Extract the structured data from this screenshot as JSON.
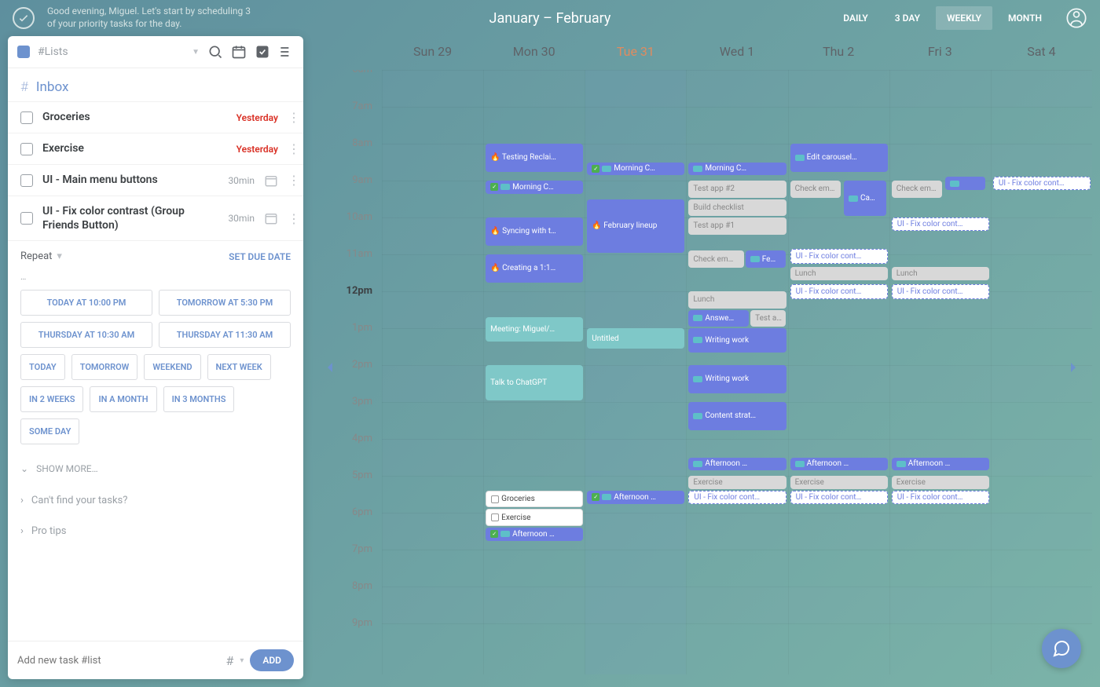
{
  "header": {
    "greeting": "Good evening, Miguel. Let's start by scheduling 3 of your priority tasks for the day.",
    "title": "January – February",
    "views": [
      "DAILY",
      "3 DAY",
      "WEEKLY",
      "MONTH"
    ],
    "active_view": "WEEKLY"
  },
  "sidebar": {
    "list_label": "#Lists",
    "section": "Inbox",
    "tasks": [
      {
        "label": "Groceries",
        "due": "Yesterday",
        "due_style": "overdue"
      },
      {
        "label": "Exercise",
        "due": "Yesterday",
        "due_style": "overdue"
      },
      {
        "label": "UI - Main menu buttons",
        "due": "30min",
        "due_style": "neutral",
        "has_cal": true
      },
      {
        "label": "UI - Fix color contrast (Group Friends Button)",
        "due": "30min",
        "due_style": "neutral",
        "has_cal": true
      }
    ],
    "repeat_label": "Repeat",
    "set_due_label": "SET DUE DATE",
    "chips_primary": [
      "TODAY AT 10:00 PM",
      "TOMORROW AT 5:30 PM",
      "THURSDAY AT 10:30 AM",
      "THURSDAY AT 11:30 AM"
    ],
    "chips_secondary": [
      "TODAY",
      "TOMORROW",
      "WEEKEND",
      "NEXT WEEK",
      "IN 2 WEEKS",
      "IN A MONTH",
      "IN 3 MONTHS",
      "SOME DAY"
    ],
    "show_more": "SHOW MORE…",
    "help": [
      "Can't find your tasks?",
      "Pro tips"
    ],
    "add_placeholder": "Add new task #list",
    "add_btn": "ADD"
  },
  "calendar": {
    "days": [
      "Sun 29",
      "Mon 30",
      "Tue 31",
      "Wed 1",
      "Thu 2",
      "Fri 3",
      "Sat 4"
    ],
    "today_index": 2,
    "hours": [
      "6am",
      "7am",
      "8am",
      "9am",
      "10am",
      "11am",
      "12pm",
      "1pm",
      "2pm",
      "3pm",
      "4pm",
      "5pm",
      "6pm",
      "7pm",
      "8pm",
      "9pm"
    ],
    "now_index": 6,
    "events": [
      {
        "day": 1,
        "start": 8,
        "dur": 0.8,
        "text": "🔥 Testing Reclai…",
        "cls": "purple"
      },
      {
        "day": 1,
        "start": 9,
        "dur": 0.4,
        "text": "Morning C…",
        "cls": "purple",
        "check": true,
        "badge": true
      },
      {
        "day": 1,
        "start": 10,
        "dur": 0.8,
        "text": "🔥 Syncing with t…",
        "cls": "purple"
      },
      {
        "day": 1,
        "start": 11,
        "dur": 0.8,
        "text": "🔥 Creating a 1:1…",
        "cls": "purple"
      },
      {
        "day": 1,
        "start": 12.7,
        "dur": 0.7,
        "text": "Meeting: Miguel/…",
        "cls": "teal"
      },
      {
        "day": 1,
        "start": 14,
        "dur": 1,
        "text": "Talk to ChatGPT",
        "cls": "teal"
      },
      {
        "day": 1,
        "start": 17.4,
        "dur": 0.5,
        "text": "Groceries",
        "cls": "white",
        "cbox": true
      },
      {
        "day": 1,
        "start": 17.9,
        "dur": 0.5,
        "text": "Exercise",
        "cls": "white",
        "cbox": true
      },
      {
        "day": 1,
        "start": 18.4,
        "dur": 0.4,
        "text": "Afternoon …",
        "cls": "purple",
        "check": true,
        "badge": true
      },
      {
        "day": 2,
        "start": 8.5,
        "dur": 0.4,
        "text": "Morning C…",
        "cls": "purple",
        "check": true,
        "badge": true
      },
      {
        "day": 2,
        "start": 9.5,
        "dur": 1.5,
        "text": "🔥 February lineup",
        "cls": "purple"
      },
      {
        "day": 2,
        "start": 13,
        "dur": 0.6,
        "text": "Untitled",
        "cls": "teal"
      },
      {
        "day": 2,
        "start": 17.4,
        "dur": 0.4,
        "text": "Afternoon …",
        "cls": "purple",
        "check": true,
        "badge": true
      },
      {
        "day": 3,
        "start": 8.5,
        "dur": 0.4,
        "text": "Morning C…",
        "cls": "purple",
        "badge": true
      },
      {
        "day": 3,
        "start": 9,
        "dur": 0.5,
        "text": "Test app #2",
        "cls": "gray"
      },
      {
        "day": 3,
        "start": 9.5,
        "dur": 0.5,
        "text": "Build checklist",
        "cls": "gray"
      },
      {
        "day": 3,
        "start": 10,
        "dur": 0.5,
        "text": "Test app #1",
        "cls": "gray"
      },
      {
        "day": 3,
        "start": 10.9,
        "dur": 0.5,
        "text": "Check em…",
        "cls": "gray",
        "w": 0.55
      },
      {
        "day": 3,
        "start": 10.9,
        "dur": 0.5,
        "text": "Fe…",
        "cls": "purple",
        "w": 0.4,
        "x": 0.58,
        "badge": true
      },
      {
        "day": 3,
        "start": 12,
        "dur": 0.5,
        "text": "Lunch",
        "cls": "gray"
      },
      {
        "day": 3,
        "start": 12.5,
        "dur": 0.5,
        "text": "Answe…",
        "cls": "purple",
        "badge": true,
        "w": 0.6
      },
      {
        "day": 3,
        "start": 12.5,
        "dur": 0.5,
        "text": "Test a…",
        "cls": "gray",
        "w": 0.35,
        "x": 0.63
      },
      {
        "day": 3,
        "start": 13,
        "dur": 0.7,
        "text": "Writing work",
        "cls": "purple",
        "badge": true
      },
      {
        "day": 3,
        "start": 14,
        "dur": 0.8,
        "text": "Writing work",
        "cls": "purple",
        "badge": true
      },
      {
        "day": 3,
        "start": 15,
        "dur": 0.8,
        "text": "Content strat…",
        "cls": "purple",
        "badge": true
      },
      {
        "day": 3,
        "start": 16.5,
        "dur": 0.4,
        "text": "Afternoon …",
        "cls": "purple",
        "badge": true
      },
      {
        "day": 3,
        "start": 17,
        "dur": 0.4,
        "text": "Exercise",
        "cls": "gray"
      },
      {
        "day": 3,
        "start": 17.4,
        "dur": 0.4,
        "text": "UI - Fix color cont…",
        "cls": "dashed"
      },
      {
        "day": 4,
        "start": 8,
        "dur": 0.8,
        "text": "Edit carousel…",
        "cls": "purple",
        "badge": true
      },
      {
        "day": 4,
        "start": 9,
        "dur": 0.5,
        "text": "Check em…",
        "cls": "gray",
        "w": 0.5
      },
      {
        "day": 4,
        "start": 9,
        "dur": 1,
        "text": "Ca…",
        "cls": "purple",
        "w": 0.42,
        "x": 0.55,
        "badge": true
      },
      {
        "day": 4,
        "start": 10.85,
        "dur": 0.45,
        "text": "UI - Fix color cont…",
        "cls": "dashed"
      },
      {
        "day": 4,
        "start": 11.35,
        "dur": 0.4,
        "text": "Lunch",
        "cls": "gray"
      },
      {
        "day": 4,
        "start": 11.8,
        "dur": 0.45,
        "text": "UI - Fix color cont…",
        "cls": "dashed"
      },
      {
        "day": 4,
        "start": 16.5,
        "dur": 0.4,
        "text": "Afternoon …",
        "cls": "purple",
        "badge": true
      },
      {
        "day": 4,
        "start": 17,
        "dur": 0.4,
        "text": "Exercise",
        "cls": "gray"
      },
      {
        "day": 4,
        "start": 17.4,
        "dur": 0.4,
        "text": "UI - Fix color cont…",
        "cls": "dashed"
      },
      {
        "day": 5,
        "start": 9,
        "dur": 0.5,
        "text": "Check em…",
        "cls": "gray",
        "w": 0.5
      },
      {
        "day": 5,
        "start": 8.9,
        "dur": 0.4,
        "text": "",
        "cls": "purple",
        "w": 0.4,
        "x": 0.55,
        "badge": true
      },
      {
        "day": 5,
        "start": 10,
        "dur": 0.4,
        "text": "UI - Fix color cont…",
        "cls": "dashed"
      },
      {
        "day": 5,
        "start": 11.35,
        "dur": 0.4,
        "text": "Lunch",
        "cls": "gray"
      },
      {
        "day": 5,
        "start": 11.8,
        "dur": 0.45,
        "text": "UI - Fix color cont…",
        "cls": "dashed"
      },
      {
        "day": 5,
        "start": 16.5,
        "dur": 0.4,
        "text": "Afternoon …",
        "cls": "purple",
        "badge": true
      },
      {
        "day": 5,
        "start": 17,
        "dur": 0.4,
        "text": "Exercise",
        "cls": "gray"
      },
      {
        "day": 5,
        "start": 17.4,
        "dur": 0.4,
        "text": "UI - Fix color cont…",
        "cls": "dashed"
      },
      {
        "day": 6,
        "start": 8.9,
        "dur": 0.4,
        "text": "UI - Fix color cont…",
        "cls": "dashed"
      }
    ]
  }
}
